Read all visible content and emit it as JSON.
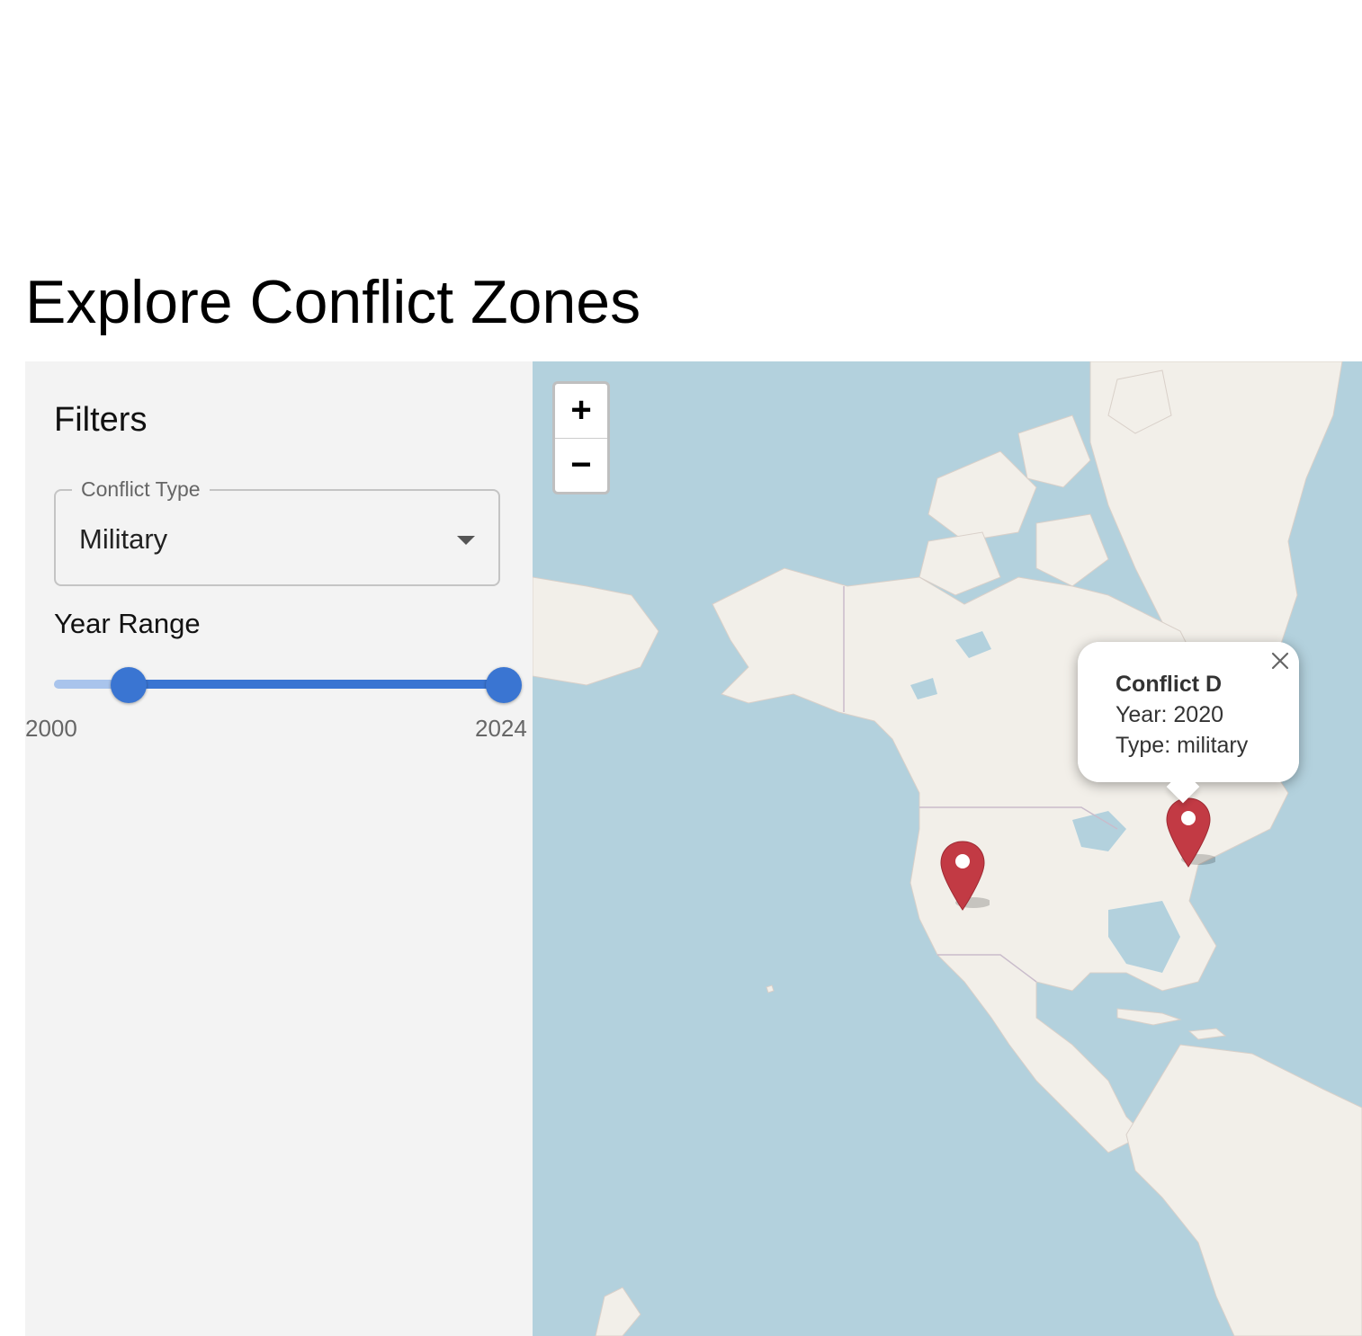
{
  "page": {
    "title": "Explore Conflict Zones"
  },
  "filters": {
    "heading": "Filters",
    "conflict_type": {
      "label": "Conflict Type",
      "value": "Military"
    },
    "year_range": {
      "label": "Year Range",
      "min_label": "2000",
      "max_label": "2024",
      "min": 2000,
      "max": 2024,
      "selected": [
        2004,
        2024
      ]
    }
  },
  "map": {
    "zoom_in": "+",
    "zoom_out": "−",
    "markers": [
      {
        "icon": "map-marker-icon",
        "color": "#c23a44"
      },
      {
        "icon": "map-marker-icon",
        "color": "#c23a44"
      }
    ],
    "popup": {
      "title": "Conflict D",
      "year": "Year: 2020",
      "type": "Type: military"
    }
  },
  "colors": {
    "accent": "#3a75d2",
    "water": "#b3d1dd",
    "land": "#f2efe9",
    "marker": "#c23a44"
  }
}
